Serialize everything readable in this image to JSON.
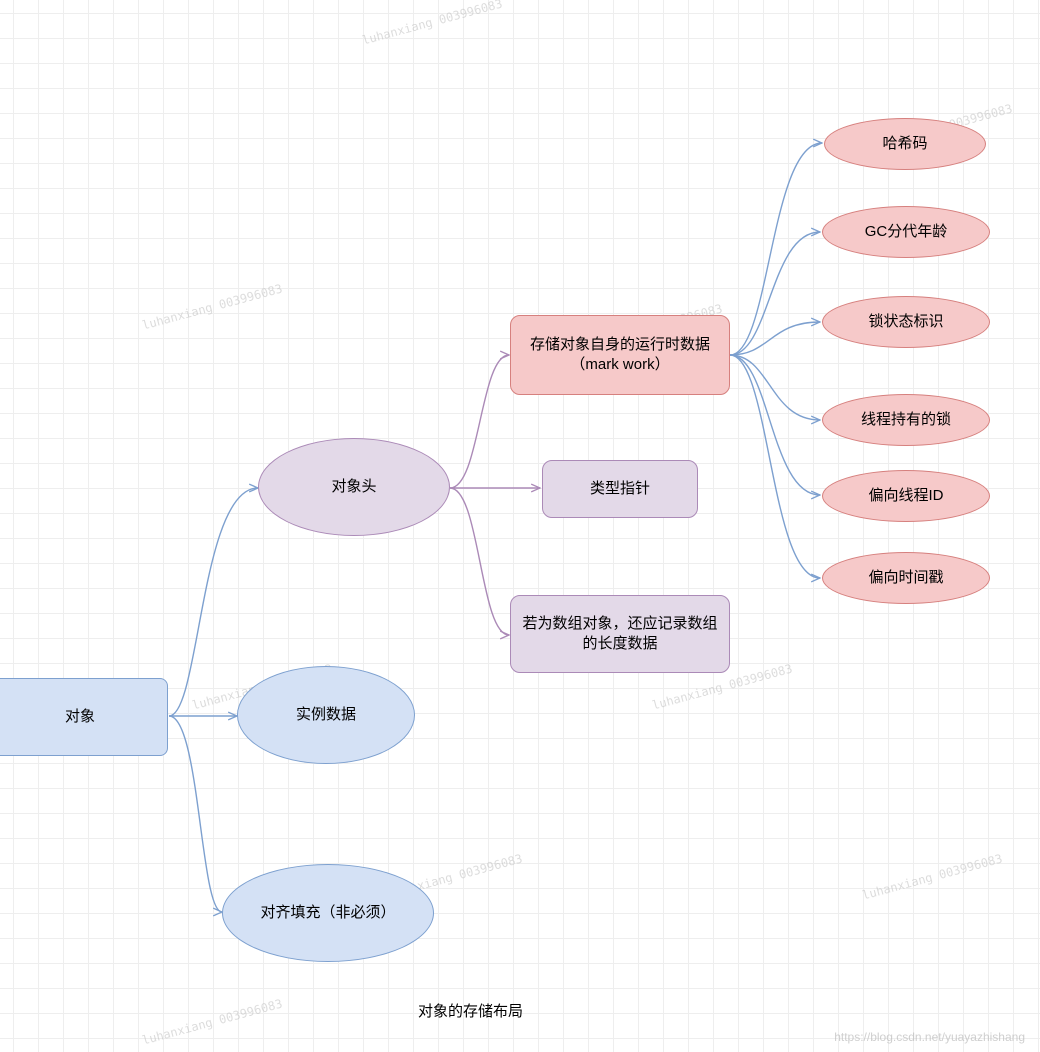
{
  "nodes": {
    "object": "对象",
    "header": "对象头",
    "instance": "实例数据",
    "padding": "对齐填充（非必须）",
    "markword": "存储对象自身的运行时数据（mark work）",
    "typeptr": "类型指针",
    "arraylen": "若为数组对象，还应记录数组的长度数据",
    "hashcode": "哈希码",
    "gcage": "GC分代年龄",
    "lockflag": "锁状态标识",
    "threadlock": "线程持有的锁",
    "biasedid": "偏向线程ID",
    "biasedts": "偏向时间戳"
  },
  "caption": "对象的存储布局",
  "watermarks": {
    "wm": "luhanxiang\n003996083"
  },
  "footer_watermark": "https://blog.csdn.net/yuayazhishang"
}
